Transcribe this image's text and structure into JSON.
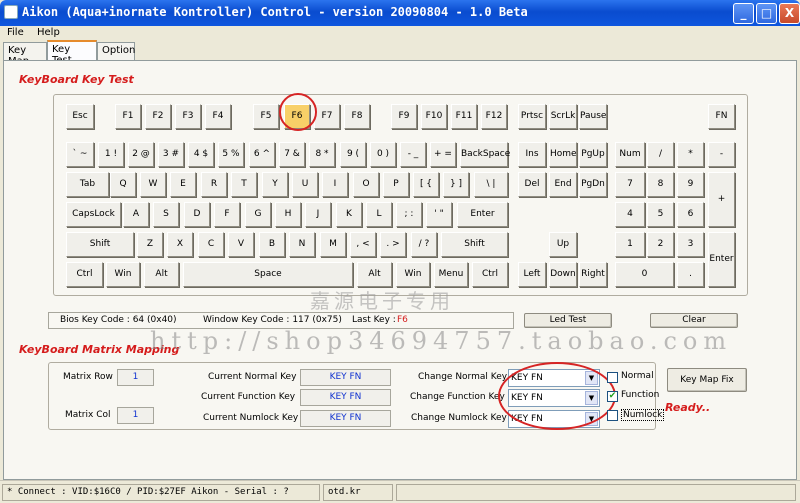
{
  "window": {
    "title": "Aikon (Aqua+inornate Kontroller) Control - version 20090804 - 1.0 Beta",
    "minimize": "_",
    "maximize": "□",
    "close": "X"
  },
  "menu": [
    "File",
    "Help"
  ],
  "tabs": [
    "Key Map",
    "Key Test",
    "Option"
  ],
  "keyboard_section_title": "KeyBoard Key Test",
  "keys": {
    "esc": "Esc",
    "f1": "F1",
    "f2": "F2",
    "f3": "F3",
    "f4": "F4",
    "f5": "F5",
    "f6": "F6",
    "f7": "F7",
    "f8": "F8",
    "f9": "F9",
    "f10": "F10",
    "f11": "F11",
    "f12": "F12",
    "prtsc": "Prtsc",
    "scrlk": "ScrLk",
    "pause": "Pause",
    "fn": "FN",
    "tilde": "` ~",
    "k1": "1 !",
    "k2": "2 @",
    "k3": "3 #",
    "k4": "4 $",
    "k5": "5 %",
    "k6": "6 ^",
    "k7": "7 &",
    "k8": "8 *",
    "k9": "9 (",
    "k0": "0 )",
    "minus": "- _",
    "equal": "+ =",
    "backspace": "BackSpace",
    "ins": "Ins",
    "home": "Home",
    "pgup": "PgUp",
    "num": "Num",
    "slash": "/",
    "star": "*",
    "nminus": "-",
    "tab": "Tab",
    "q": "Q",
    "w": "W",
    "e": "E",
    "r": "R",
    "t": "T",
    "y": "Y",
    "u": "U",
    "i": "I",
    "o": "O",
    "p": "P",
    "lbr": "[ {",
    "rbr": "} ]",
    "bslash": "\\ |",
    "del": "Del",
    "end": "End",
    "pgdn": "PgDn",
    "n7": "7",
    "n8": "8",
    "n9": "9",
    "nplus": "+",
    "caps": "CapsLock",
    "a": "A",
    "s": "S",
    "d": "D",
    "f": "F",
    "g": "G",
    "h": "H",
    "j": "J",
    "k": "K",
    "l": "L",
    "semi": "; :",
    "quote": "' \"",
    "enter": "Enter",
    "n4": "4",
    "n5": "5",
    "n6": "6",
    "lshift": "Shift",
    "z": "Z",
    "x": "X",
    "c": "C",
    "v": "V",
    "b": "B",
    "n": "N",
    "m": "M",
    "comma": ", <",
    "period": ". >",
    "qslash": "/ ?",
    "rshift": "Shift",
    "up": "Up",
    "n1": "1",
    "n2": "2",
    "n3": "3",
    "nenter": "Enter",
    "lctrl": "Ctrl",
    "lwin": "Win",
    "lalt": "Alt",
    "space": "Space",
    "ralt": "Alt",
    "rwin": "Win",
    "menu": "Menu",
    "rctrl": "Ctrl",
    "left": "Left",
    "down": "Down",
    "right": "Right",
    "n0": "0",
    "ndot": "."
  },
  "info": {
    "bios_label": "Bios Key Code : 64 (0x40)",
    "window_label": "Window Key Code : 117 (0x75)",
    "last_key_label": "Last Key :",
    "last_key_value": "F6",
    "led_test": "Led Test",
    "clear": "Clear"
  },
  "matrix_section_title": "KeyBoard Matrix Mapping",
  "matrix": {
    "row_label": "Matrix Row",
    "row_value": "1",
    "col_label": "Matrix Col",
    "col_value": "1",
    "current_normal_label": "Current Normal Key",
    "current_normal_value": "KEY FN",
    "current_function_label": "Current Function Key",
    "current_function_value": "KEY FN",
    "current_numlock_label": "Current Numlock Key",
    "current_numlock_value": "KEY FN",
    "change_normal_label": "Change Normal Key",
    "change_normal_value": "KEY FN",
    "change_function_label": "Change Function Key",
    "change_function_value": "KEY FN",
    "change_numlock_label": "Change Numlock Key",
    "change_numlock_value": "KEY FN",
    "normal_cb": "Normal",
    "function_cb": "Function",
    "numlock_cb": "Numlock",
    "keymap_fix": "Key Map Fix",
    "ready": "Ready.."
  },
  "watermark": {
    "line1": "嘉源电子专用",
    "line2": "http://shop34694757.taobao.com"
  },
  "status": {
    "connect": "* Connect : VID:$16C0 / PID:$27EF Aikon - Serial : ?",
    "site": "otd.kr"
  },
  "colors": {
    "titlebar": "#0a4ccf",
    "accent_red": "#d51c1c",
    "highlight_key": "#f8d068",
    "value_blue": "#1032d0"
  }
}
